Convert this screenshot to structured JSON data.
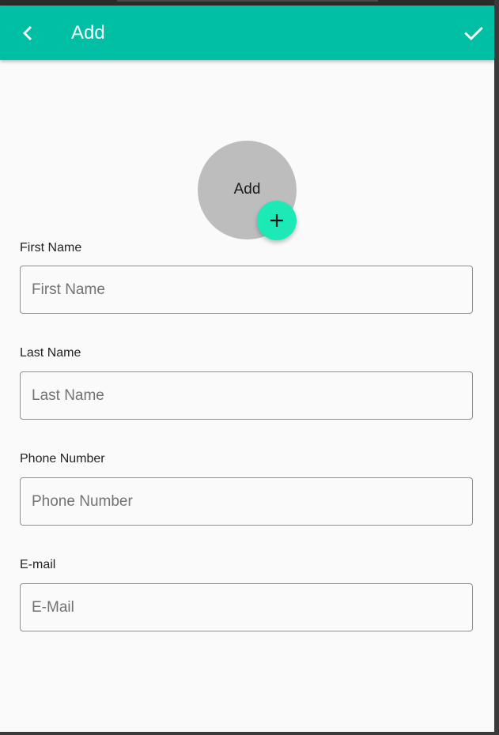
{
  "appbar": {
    "title": "Add",
    "back_icon": "chevron-left-icon",
    "confirm_icon": "check-icon",
    "color": "#00bfa5"
  },
  "avatar": {
    "label": "Add",
    "color": "#bdbdbd",
    "fab_icon": "plus-icon",
    "fab_color": "#1de9b6"
  },
  "form": {
    "first_name": {
      "label": "First Name",
      "placeholder": "First Name",
      "value": ""
    },
    "last_name": {
      "label": "Last Name",
      "placeholder": "Last Name",
      "value": ""
    },
    "phone": {
      "label": "Phone Number",
      "placeholder": "Phone Number",
      "value": ""
    },
    "email": {
      "label": "E-mail",
      "placeholder": "E-Mail",
      "value": ""
    }
  }
}
